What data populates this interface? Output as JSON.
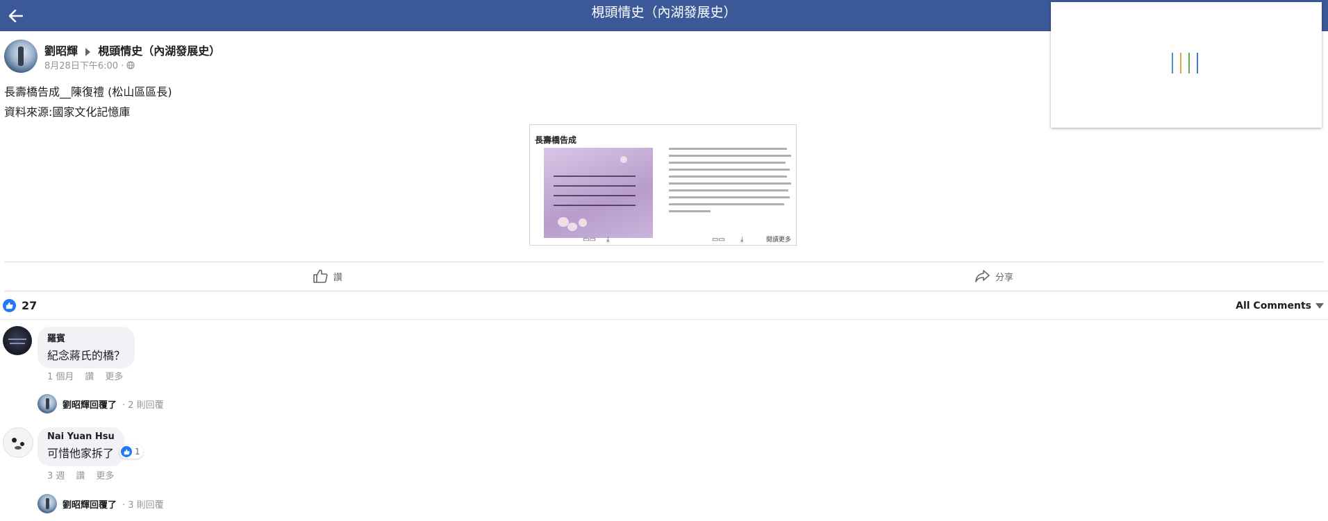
{
  "header": {
    "title": "梘頭情史（內湖發展史）"
  },
  "post": {
    "author": "劉昭輝",
    "group": "梘頭情史（內湖發展史）",
    "timestamp": "8月28日下午6:00",
    "privacy_separator": "·",
    "text_line1": "長壽橋告成__陳復禮 (松山區區長)",
    "text_line2": "資料來源:國家文化記憶庫",
    "attachment": {
      "title": "長壽橋告成",
      "read_more": "閱讀更多"
    }
  },
  "actions": {
    "like_label": "讚",
    "share_label": "分享"
  },
  "reactions": {
    "count": "27"
  },
  "comments_filter": "All Comments",
  "comments": [
    {
      "name": "羅賓",
      "text": "紀念蔣氏的橋？",
      "time": "1 個月",
      "like": "讚",
      "more": "更多",
      "reply_author": "劉昭輝回覆了",
      "reply_count": "· 2 則回覆"
    },
    {
      "name": "Nai Yuan Hsu",
      "text": "可惜他家拆了",
      "reaction_count": "1",
      "time": "3 週",
      "like": "讚",
      "more": "更多",
      "reply_author": "劉昭輝回覆了",
      "reply_count": "· 3 則回覆"
    }
  ],
  "colors": {
    "brand": "#3b5998",
    "like_blue": "#2078f4",
    "loader": [
      "#4a90c8",
      "#e8a33c",
      "#6aa84f",
      "#3c78d8"
    ]
  }
}
